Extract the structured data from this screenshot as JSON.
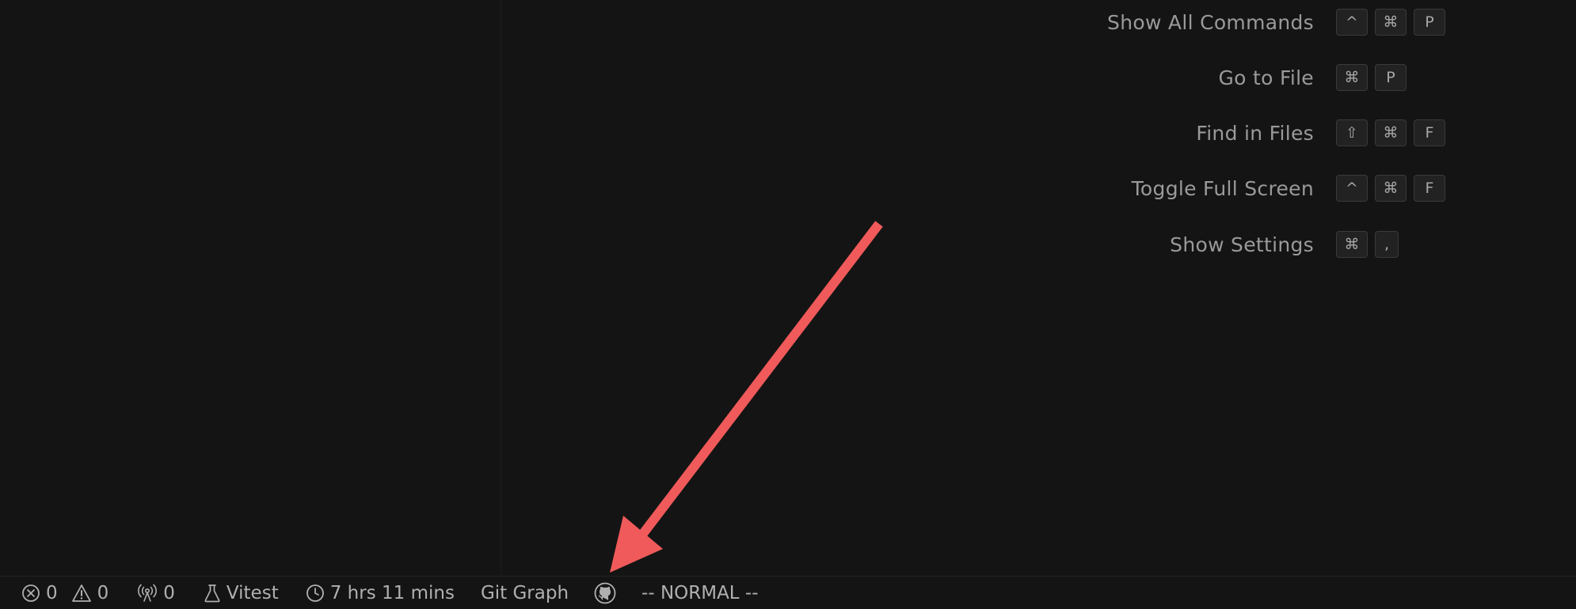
{
  "shortcuts": [
    {
      "label": "Show All Commands",
      "keys": [
        "^",
        "⌘",
        "P"
      ]
    },
    {
      "label": "Go to File",
      "keys": [
        "⌘",
        "P"
      ]
    },
    {
      "label": "Find in Files",
      "keys": [
        "⇧",
        "⌘",
        "F"
      ]
    },
    {
      "label": "Toggle Full Screen",
      "keys": [
        "^",
        "⌘",
        "F"
      ]
    },
    {
      "label": "Show Settings",
      "keys": [
        "⌘",
        ","
      ]
    }
  ],
  "statusbar": {
    "errors": "0",
    "warnings": "0",
    "ports": "0",
    "vitest_label": "Vitest",
    "time_tracked": "7 hrs 11 mins",
    "git_graph_label": "Git Graph",
    "github_icon": "github-icon",
    "vim_mode": "-- NORMAL --"
  },
  "annotation": {
    "arrow_color": "#f05a5a"
  }
}
